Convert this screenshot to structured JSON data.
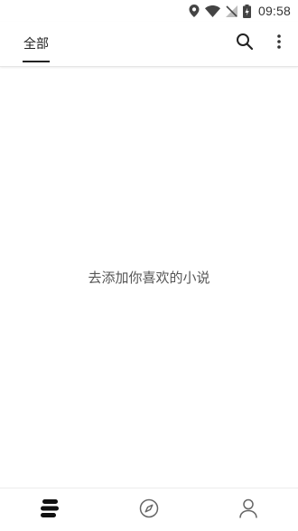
{
  "status_bar": {
    "time": "09:58",
    "icons": [
      "location-icon",
      "wifi-icon",
      "no-signal-icon",
      "battery-charging-icon"
    ]
  },
  "app_bar": {
    "tab_all_label": "全部",
    "search_icon": "search-icon",
    "more_icon": "more-vertical-icon"
  },
  "main": {
    "empty_message": "去添加你喜欢的小说"
  },
  "bottom_nav": {
    "items": [
      {
        "icon": "bookshelf-icon",
        "selected": true
      },
      {
        "icon": "compass-icon",
        "selected": false
      },
      {
        "icon": "profile-icon",
        "selected": false
      }
    ]
  },
  "colors": {
    "text_primary": "#222222",
    "text_secondary": "#555555",
    "icon_inactive": "#666666"
  }
}
